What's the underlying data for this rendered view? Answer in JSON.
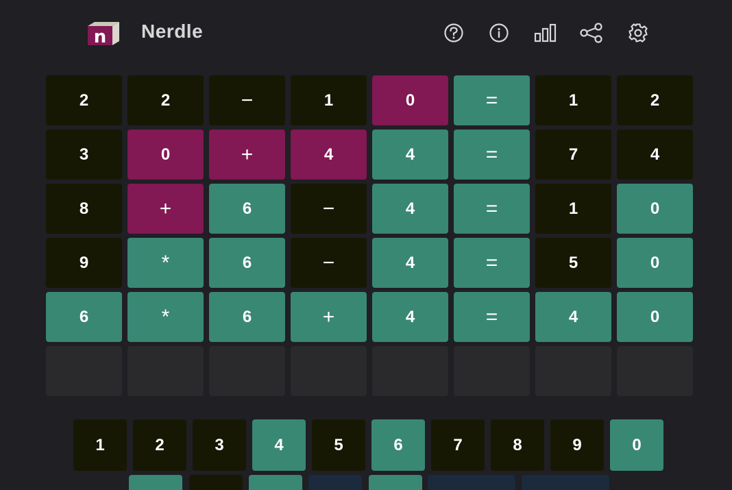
{
  "app": {
    "title": "Nerdle",
    "logo_letter": "n",
    "icons": [
      "help-icon",
      "info-icon",
      "stats-icon",
      "share-icon",
      "settings-icon"
    ]
  },
  "colors": {
    "correct": "#398874",
    "present": "#821854",
    "absent": "#161803",
    "empty": "#2a2a2c",
    "background": "#1f1f24",
    "unused_key": "#1b2a3d"
  },
  "board": {
    "rows": [
      [
        {
          "ch": "2",
          "state": "absent"
        },
        {
          "ch": "2",
          "state": "absent"
        },
        {
          "ch": "−",
          "state": "absent"
        },
        {
          "ch": "1",
          "state": "absent"
        },
        {
          "ch": "0",
          "state": "present"
        },
        {
          "ch": "=",
          "state": "correct"
        },
        {
          "ch": "1",
          "state": "absent"
        },
        {
          "ch": "2",
          "state": "absent"
        }
      ],
      [
        {
          "ch": "3",
          "state": "absent"
        },
        {
          "ch": "0",
          "state": "present"
        },
        {
          "ch": "+",
          "state": "present"
        },
        {
          "ch": "4",
          "state": "present"
        },
        {
          "ch": "4",
          "state": "correct"
        },
        {
          "ch": "=",
          "state": "correct"
        },
        {
          "ch": "7",
          "state": "absent"
        },
        {
          "ch": "4",
          "state": "absent"
        }
      ],
      [
        {
          "ch": "8",
          "state": "absent"
        },
        {
          "ch": "+",
          "state": "present"
        },
        {
          "ch": "6",
          "state": "correct"
        },
        {
          "ch": "−",
          "state": "absent"
        },
        {
          "ch": "4",
          "state": "correct"
        },
        {
          "ch": "=",
          "state": "correct"
        },
        {
          "ch": "1",
          "state": "absent"
        },
        {
          "ch": "0",
          "state": "correct"
        }
      ],
      [
        {
          "ch": "9",
          "state": "absent"
        },
        {
          "ch": "*",
          "state": "correct"
        },
        {
          "ch": "6",
          "state": "correct"
        },
        {
          "ch": "−",
          "state": "absent"
        },
        {
          "ch": "4",
          "state": "correct"
        },
        {
          "ch": "=",
          "state": "correct"
        },
        {
          "ch": "5",
          "state": "absent"
        },
        {
          "ch": "0",
          "state": "correct"
        }
      ],
      [
        {
          "ch": "6",
          "state": "correct"
        },
        {
          "ch": "*",
          "state": "correct"
        },
        {
          "ch": "6",
          "state": "correct"
        },
        {
          "ch": "+",
          "state": "correct"
        },
        {
          "ch": "4",
          "state": "correct"
        },
        {
          "ch": "=",
          "state": "correct"
        },
        {
          "ch": "4",
          "state": "correct"
        },
        {
          "ch": "0",
          "state": "correct"
        }
      ],
      [
        {
          "ch": "",
          "state": "empty"
        },
        {
          "ch": "",
          "state": "empty"
        },
        {
          "ch": "",
          "state": "empty"
        },
        {
          "ch": "",
          "state": "empty"
        },
        {
          "ch": "",
          "state": "empty"
        },
        {
          "ch": "",
          "state": "empty"
        },
        {
          "ch": "",
          "state": "empty"
        },
        {
          "ch": "",
          "state": "empty"
        }
      ]
    ]
  },
  "keyboard": {
    "digits": [
      {
        "ch": "1",
        "state": "absent"
      },
      {
        "ch": "2",
        "state": "absent"
      },
      {
        "ch": "3",
        "state": "absent"
      },
      {
        "ch": "4",
        "state": "correct"
      },
      {
        "ch": "5",
        "state": "absent"
      },
      {
        "ch": "6",
        "state": "correct"
      },
      {
        "ch": "7",
        "state": "absent"
      },
      {
        "ch": "8",
        "state": "absent"
      },
      {
        "ch": "9",
        "state": "absent"
      },
      {
        "ch": "0",
        "state": "correct"
      }
    ],
    "second_row_states": [
      "correct",
      "absent",
      "correct",
      "unused",
      "correct",
      "unused-wide",
      "unused-wide"
    ]
  }
}
